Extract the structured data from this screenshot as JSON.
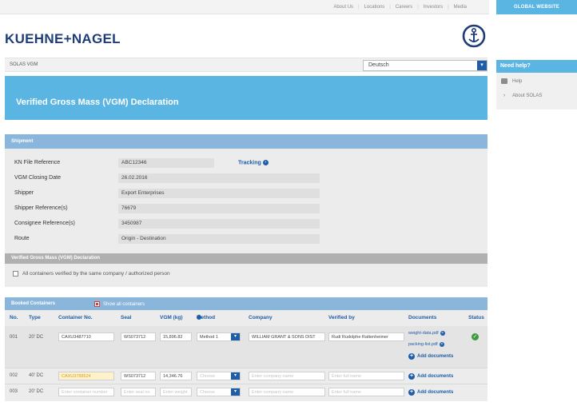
{
  "top_links": [
    "About Us",
    "Locations",
    "Careers",
    "Investors",
    "Media"
  ],
  "global_website": "GLOBAL WEBSITE",
  "brand": "KUEHNE+NAGEL",
  "breadcrumb": "SOLAS VGM",
  "language": {
    "selected": "Deutsch"
  },
  "banner_title": "Verified Gross Mass (VGM) Declaration",
  "sidebar": {
    "title": "Need help?",
    "items": [
      {
        "label": "Help",
        "icon": "book-icon"
      },
      {
        "label": "About SOLAS",
        "icon": "chevron-right-icon"
      }
    ]
  },
  "shipment": {
    "title": "Shipment",
    "fields": [
      {
        "label": "KN File Reference",
        "value": "ABC12346"
      },
      {
        "label": "VGM Closing Date",
        "value": "26.02.2016"
      },
      {
        "label": "Shipper",
        "value": "Export Enterprises"
      },
      {
        "label": "Shipper Reference(s)",
        "value": "76679"
      },
      {
        "label": "Consignee Reference(s)",
        "value": "3450987"
      },
      {
        "label": "Route",
        "value": "Origin - Destination"
      }
    ],
    "tracking_label": "Tracking",
    "vgm_section_title": "Verified Gross Mass (VGM) Declaration",
    "same_company_label": "All containers verified by the same company / authorized person"
  },
  "booked": {
    "title": "Booked Containers",
    "show_all": "Show all containers",
    "columns": [
      "No.",
      "Type",
      "Container No.",
      "Seal",
      "VGM (kg)",
      "Method",
      "Company",
      "Verified by",
      "Documents",
      "Status"
    ],
    "rows": [
      {
        "no": "001",
        "type": "20' DC",
        "container": "CAXU3487710",
        "seal": "WS073712",
        "vgm": "15,896.82",
        "method": "Method 1",
        "company": "WILLIAM GRANT & SONS DIST",
        "verified_by": "Rudi Rudolphe Rattenheimer",
        "documents": [
          "weight-data.pdf",
          "packing-list.pdf"
        ],
        "add_docs": "Add documents",
        "status": "verified"
      },
      {
        "no": "002",
        "type": "40' DC",
        "container": "CAXU3788524",
        "seal": "WS073712",
        "vgm": "14,346.76",
        "method_placeholder": "Choose",
        "company_placeholder": "Enter company name",
        "verified_placeholder": "Enter full name",
        "add_docs": "Add documents"
      },
      {
        "no": "003",
        "type": "20' DC",
        "container_placeholder": "Enter container number",
        "seal_placeholder": "Enter seal no",
        "vgm_placeholder": "Enter weight",
        "method_placeholder": "Choose",
        "company_placeholder": "Enter company name",
        "verified_placeholder": "Enter full name",
        "add_docs": "Add documents"
      }
    ]
  },
  "colors": {
    "accent": "#5bb5e3",
    "panel_head": "#8ab6dc",
    "link": "#1f5da8",
    "brand": "#1f3d7a",
    "ok": "#3e9a3c"
  }
}
